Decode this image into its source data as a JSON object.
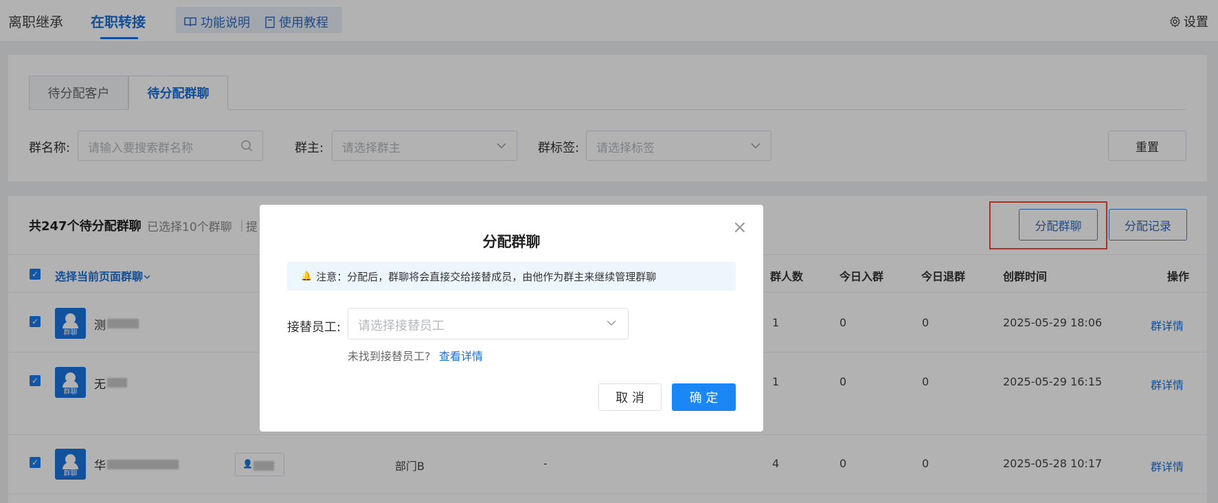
{
  "top_nav": {
    "tabs": [
      {
        "label": "离职继承",
        "active": false
      },
      {
        "label": "在职转接",
        "active": true
      }
    ],
    "feature_doc": "功能说明",
    "tutorial": "使用教程",
    "settings": "设置"
  },
  "sub_tabs": [
    {
      "label": "待分配客户",
      "active": false
    },
    {
      "label": "待分配群聊",
      "active": true
    }
  ],
  "filters": {
    "group_name_label": "群名称:",
    "group_name_placeholder": "请输入要搜索群名称",
    "owner_label": "群主:",
    "owner_placeholder": "请选择群主",
    "tag_label": "群标签:",
    "tag_placeholder": "请选择标签",
    "reset": "重置"
  },
  "list": {
    "count_title": "共247个待分配群聊",
    "selected_info": "已选择10个群聊",
    "separator": "|",
    "extra_truncated": "提",
    "assign_button": "分配群聊",
    "records_button": "分配记录",
    "select_page": "选择当前页面群聊",
    "columns": {
      "members": "群人数",
      "joined_today": "今日入群",
      "left_today": "今日退群",
      "created": "创群时间",
      "actions": "操作"
    },
    "rows": [
      {
        "name": "测",
        "department": "",
        "tag": "",
        "members": "1",
        "joined_today": "0",
        "left_today": "0",
        "created": "2025-05-29 18:06",
        "action": "群详情"
      },
      {
        "name": "无",
        "department": "",
        "tag": "",
        "members": "1",
        "joined_today": "0",
        "left_today": "0",
        "created": "2025-05-29 16:15",
        "action": "群详情"
      },
      {
        "name": "华",
        "department": "部门B",
        "tag": "-",
        "members": "4",
        "joined_today": "0",
        "left_today": "0",
        "created": "2025-05-28 10:17",
        "action": "群详情"
      }
    ],
    "avatar_label": "群聊"
  },
  "modal": {
    "title": "分配群聊",
    "notice": "注意：分配后，群聊将会直接交给接替成员，由他作为群主来继续管理群聊",
    "field_label": "接替员工:",
    "field_placeholder": "请选择接替员工",
    "helper_text": "未找到接替员工?",
    "helper_link": "查看详情",
    "cancel": "取 消",
    "confirm": "确 定"
  }
}
